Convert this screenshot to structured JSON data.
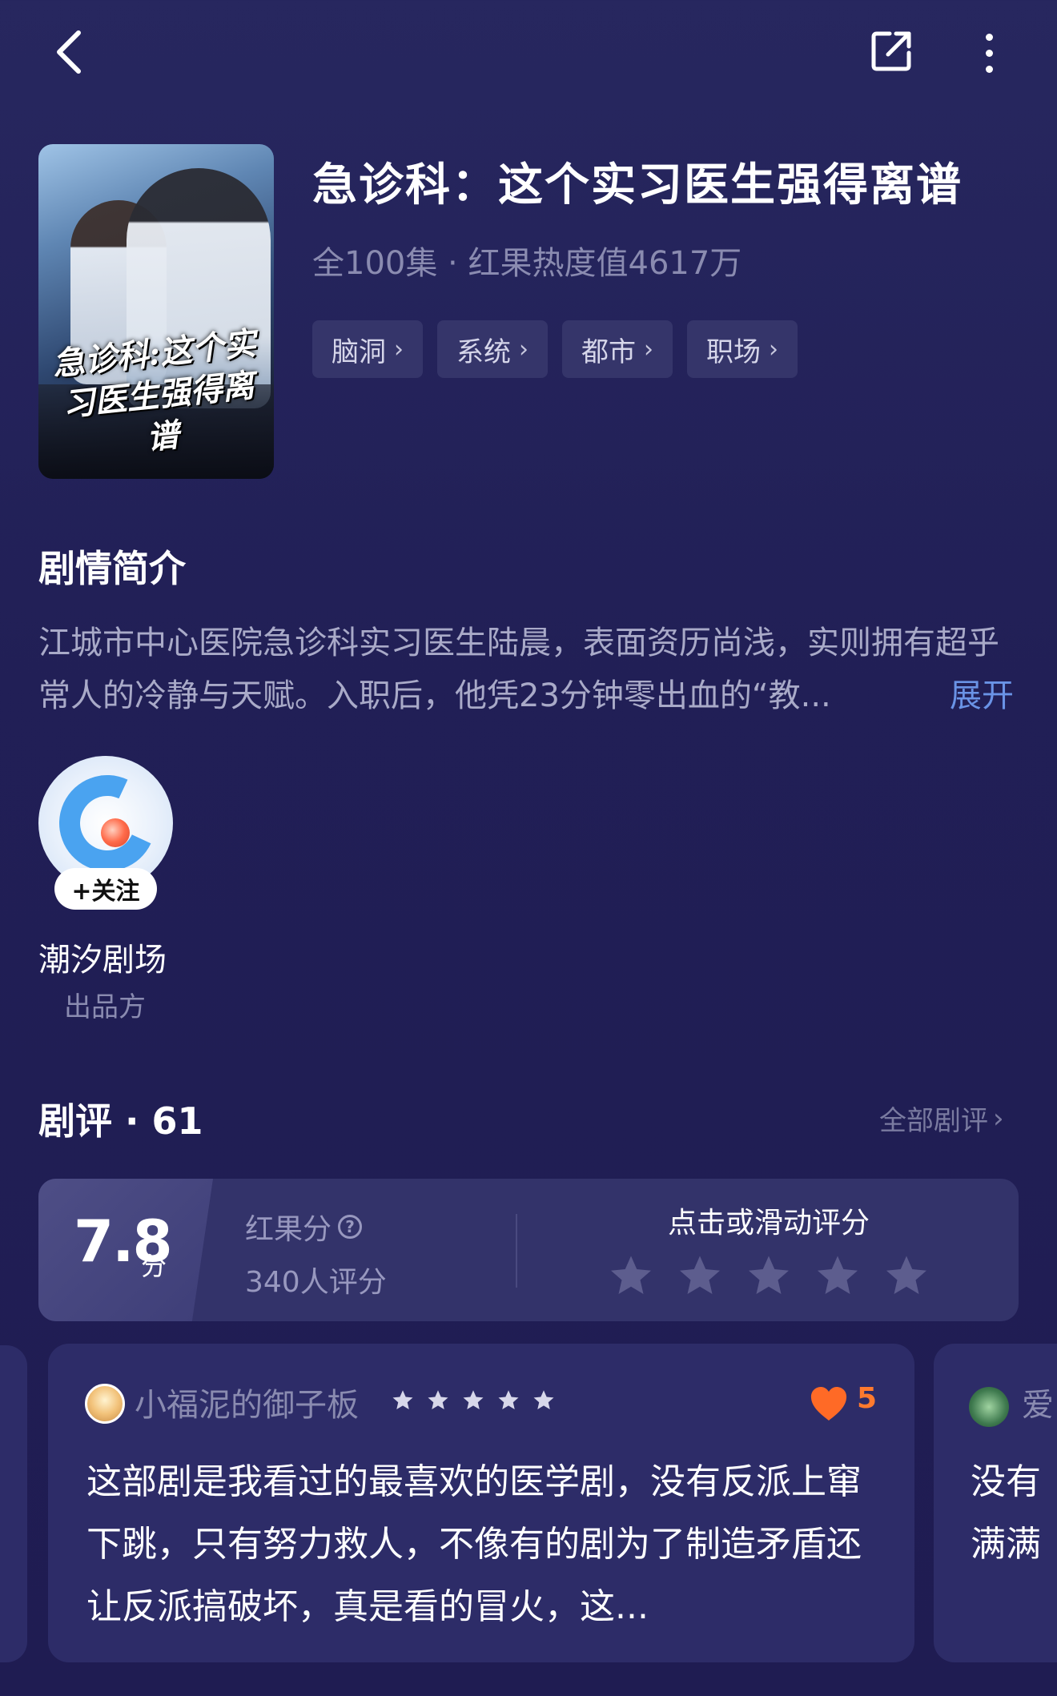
{
  "header": {
    "back_icon": "chevron-left-icon",
    "share_icon": "share-icon",
    "more_icon": "more-vertical-icon"
  },
  "show": {
    "poster_title": "急诊科:这个实习医生强得离谱",
    "title": "急诊科：这个实习医生强得离谱",
    "meta": "全100集 · 红果热度值4617万",
    "tags": [
      {
        "label": "脑洞"
      },
      {
        "label": "系统"
      },
      {
        "label": "都市"
      },
      {
        "label": "职场"
      }
    ]
  },
  "synopsis": {
    "heading": "剧情简介",
    "text": "江城市中心医院急诊科实习医生陆晨，表面资历尚浅，实则拥有超乎常人的冷静与天赋。入职后，他凭23分钟零出血的“教...",
    "expand_label": "展开"
  },
  "producer": {
    "follow_label": "+关注",
    "name": "潮汐剧场",
    "role": "出品方"
  },
  "reviews": {
    "heading": "剧评 · 61",
    "all_label": "全部剧评",
    "rating": {
      "score": "7.8",
      "unit": "分",
      "label": "红果分",
      "count": "340人评分",
      "prompt": "点击或滑动评分",
      "score_value": 7.8,
      "stars_total": 5
    },
    "items": [
      {
        "name": "小福泥的御子板",
        "stars": 5,
        "likes": "5",
        "text": "这部剧是我看过的最喜欢的医学剧，没有反派上窜下跳，只有努力救人，不像有的剧为了制造矛盾还让反派搞破坏，真是看的冒火，这..."
      },
      {
        "name": "爱",
        "text": "没有\n满满"
      }
    ]
  },
  "colors": {
    "background": "#25245c",
    "accent_blue": "#6a93e6",
    "like_orange": "#ff7a2e"
  }
}
